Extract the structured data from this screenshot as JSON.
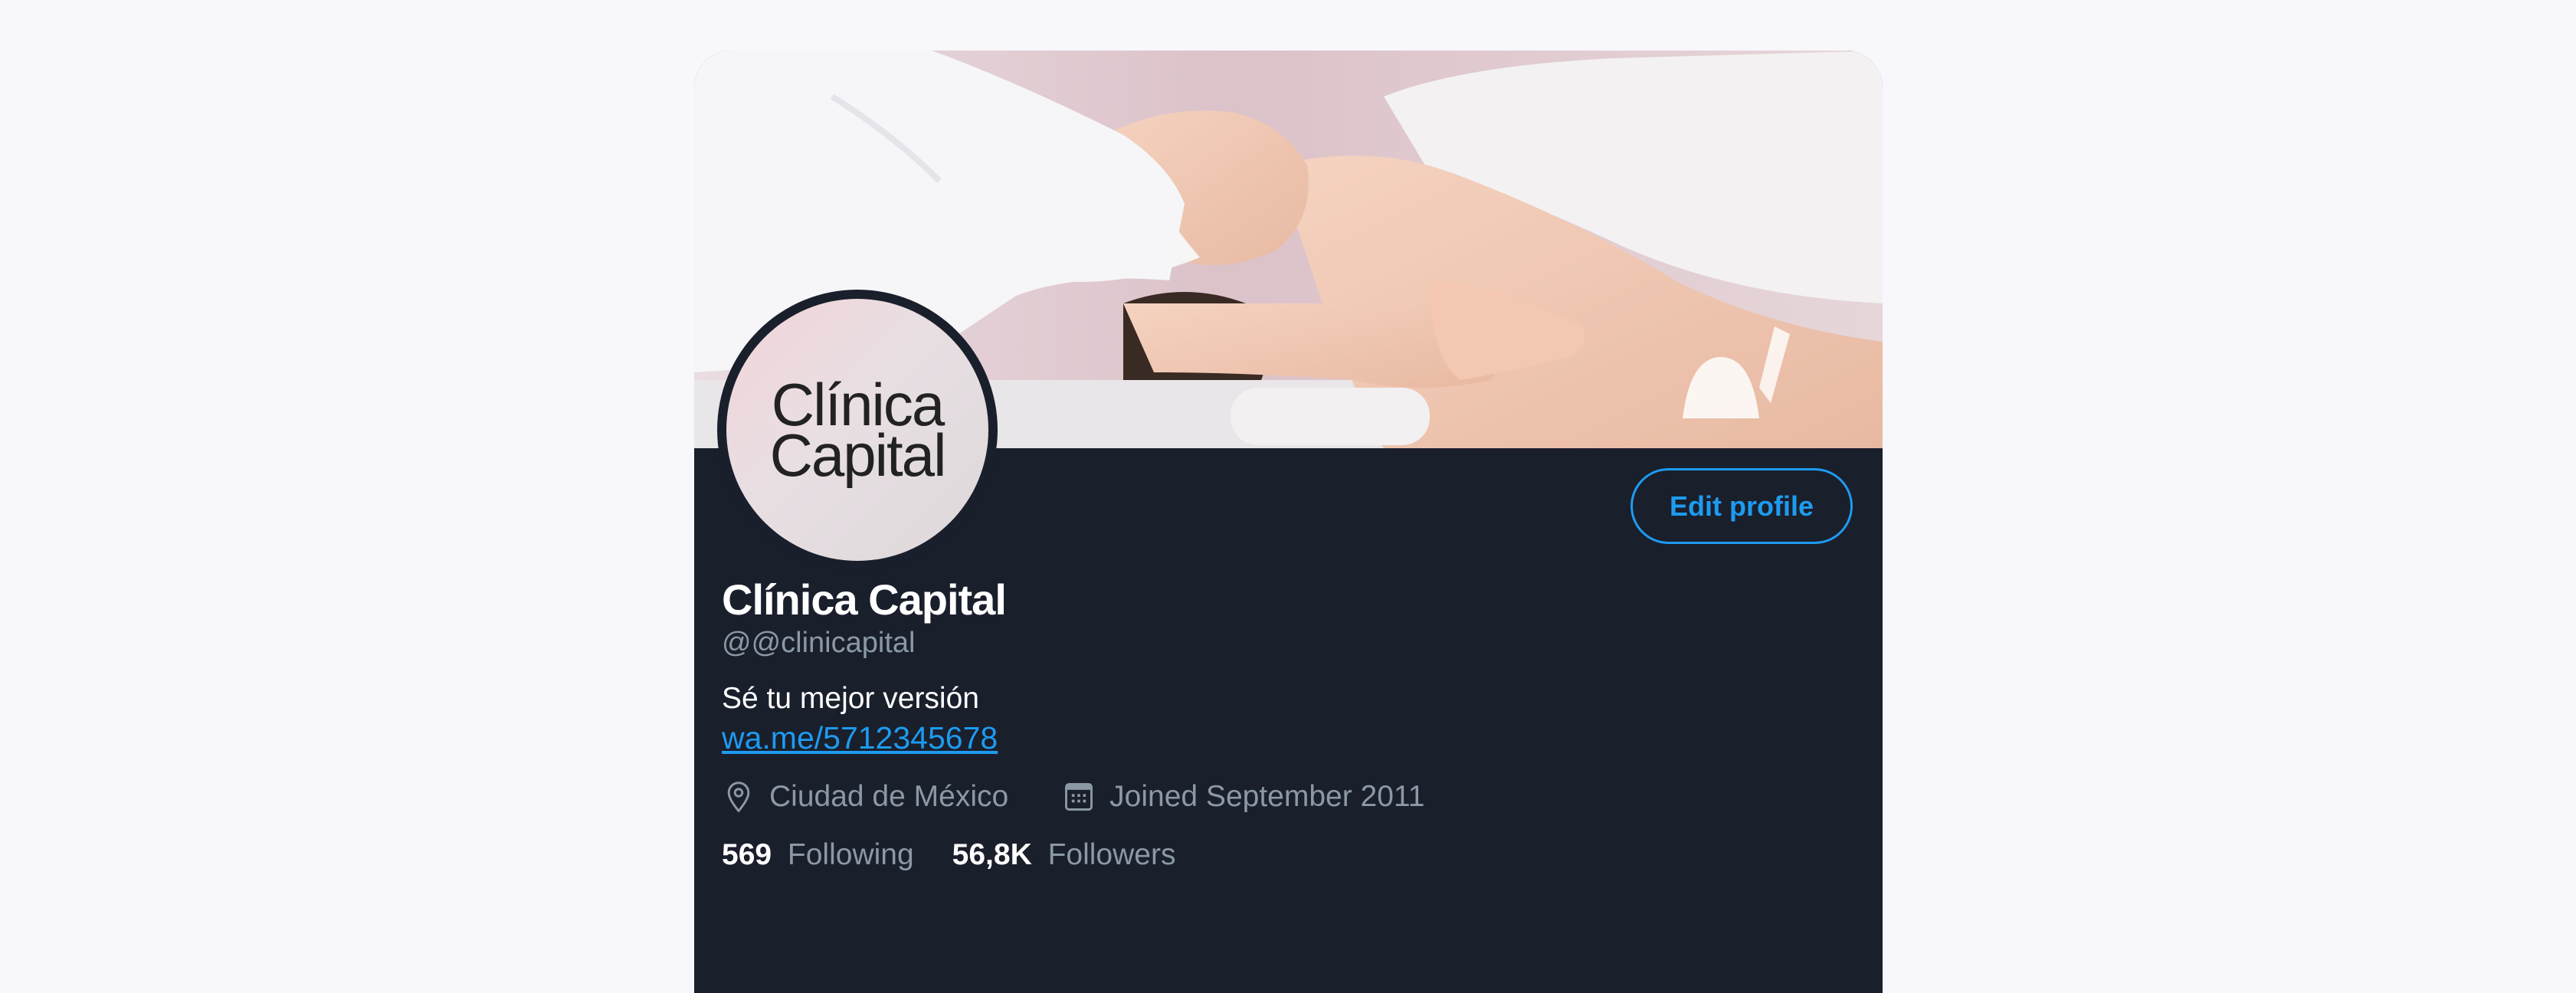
{
  "profile": {
    "avatar_text_line1": "Clínica",
    "avatar_text_line2": "Capital",
    "display_name": "Clínica Capital",
    "handle": "@@clinicapital",
    "bio": "Sé tu mejor versión",
    "link": "wa.me/5712345678",
    "location": "Ciudad de México",
    "joined": "Joined September 2011"
  },
  "actions": {
    "edit_profile_label": "Edit profile"
  },
  "stats": {
    "following_count": "569",
    "following_label": "Following",
    "followers_count": "56,8K",
    "followers_label": "Followers"
  },
  "icons": {
    "location": "map-pin-icon",
    "joined": "calendar-icon"
  },
  "colors": {
    "accent": "#1d9bf0",
    "card_bg": "#1a1f2c",
    "muted_text": "#8b98a5",
    "page_bg": "#f8f7fb"
  }
}
